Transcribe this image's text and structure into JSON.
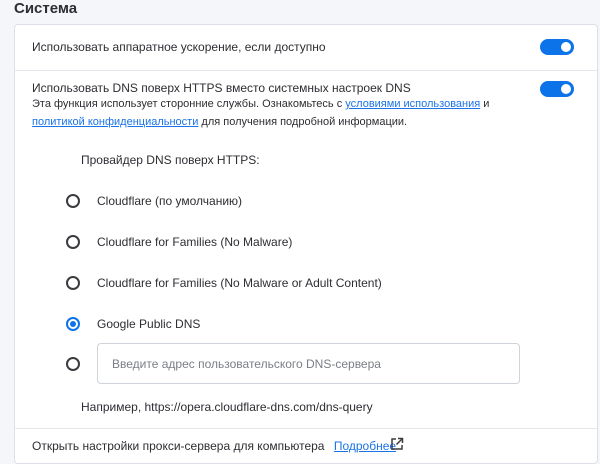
{
  "section_title": "Система",
  "hardware_accel": {
    "label": "Использовать аппаратное ускорение, если доступно",
    "enabled": true
  },
  "dns_over_https": {
    "label": "Использовать DNS поверх HTTPS вместо системных настроек DNS",
    "enabled": true,
    "desc_part1": "Эта функция использует сторонние службы. Ознакомьтесь с",
    "terms_link": "условиями использования",
    "desc_and": "и",
    "privacy_link": "политикой конфиденциальности",
    "desc_part2": "для получения подробной информации.",
    "provider_label": "Провайдер DNS поверх HTTPS:",
    "options": [
      {
        "label": "Cloudflare (по умолчанию)",
        "selected": false
      },
      {
        "label": "Cloudflare for Families (No Malware)",
        "selected": false
      },
      {
        "label": "Cloudflare for Families (No Malware or Adult Content)",
        "selected": false
      },
      {
        "label": "Google Public DNS",
        "selected": true
      }
    ],
    "custom_placeholder": "Введите адрес пользовательского DNS-сервера",
    "example": "Например, https://opera.cloudflare-dns.com/dns-query"
  },
  "proxy": {
    "label": "Открыть настройки прокси-сервера для компьютера",
    "more_link": "Подробнее",
    "icon": "external-link-icon"
  },
  "colors": {
    "accent": "#0d73e8",
    "link": "#1a73e8"
  }
}
